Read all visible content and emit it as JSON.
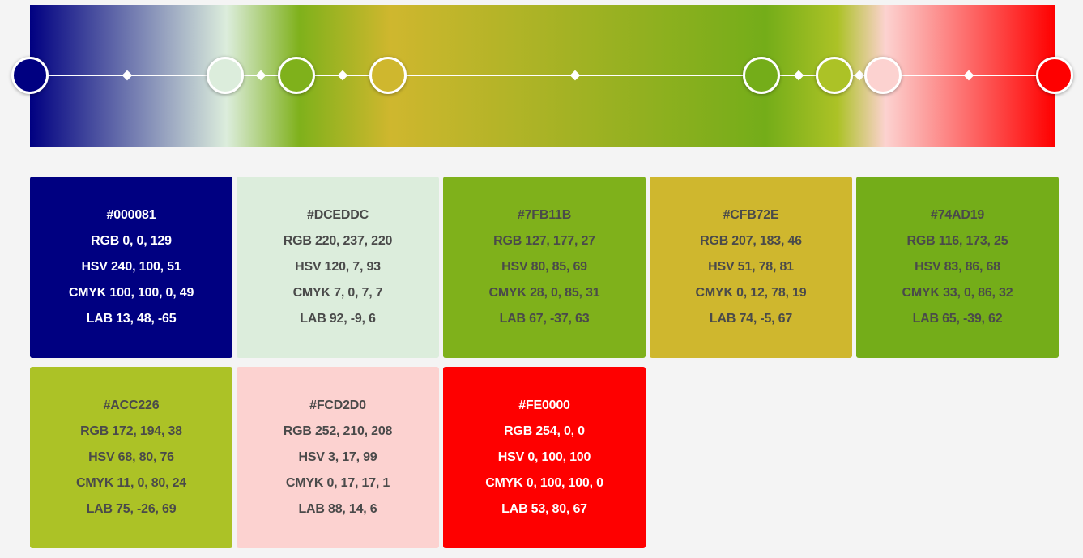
{
  "gradient": {
    "stops": [
      {
        "hex": "#000081",
        "color": "#000081"
      },
      {
        "hex": "#DCEDDC",
        "color": "#DCEDDC"
      },
      {
        "hex": "#7FB11B",
        "color": "#7FB11B"
      },
      {
        "hex": "#CFB72E",
        "color": "#CFB72E"
      },
      {
        "hex": "#74AD19",
        "color": "#74AD19"
      },
      {
        "hex": "#ACC226",
        "color": "#ACC226"
      },
      {
        "hex": "#FCD2D0",
        "color": "#FCD2D0"
      },
      {
        "hex": "#FE0000",
        "color": "#FE0000"
      }
    ]
  },
  "swatches": [
    {
      "hex": "#000081",
      "rgb": "RGB 0, 0, 129",
      "hsv": "HSV 240, 100, 51",
      "cmyk": "CMYK 100, 100, 0, 49",
      "lab": "LAB 13, 48, -65",
      "color": "#000081",
      "text": "light"
    },
    {
      "hex": "#DCEDDC",
      "rgb": "RGB 220, 237, 220",
      "hsv": "HSV 120, 7, 93",
      "cmyk": "CMYK 7, 0, 7, 7",
      "lab": "LAB 92, -9, 6",
      "color": "#DCEDDC",
      "text": "dark"
    },
    {
      "hex": "#7FB11B",
      "rgb": "RGB 127, 177, 27",
      "hsv": "HSV 80, 85, 69",
      "cmyk": "CMYK 28, 0, 85, 31",
      "lab": "LAB 67, -37, 63",
      "color": "#7FB11B",
      "text": "dark"
    },
    {
      "hex": "#CFB72E",
      "rgb": "RGB 207, 183, 46",
      "hsv": "HSV 51, 78, 81",
      "cmyk": "CMYK 0, 12, 78, 19",
      "lab": "LAB 74, -5, 67",
      "color": "#CFB72E",
      "text": "dark"
    },
    {
      "hex": "#74AD19",
      "rgb": "RGB 116, 173, 25",
      "hsv": "HSV 83, 86, 68",
      "cmyk": "CMYK 33, 0, 86, 32",
      "lab": "LAB 65, -39, 62",
      "color": "#74AD19",
      "text": "dark"
    },
    {
      "hex": "#ACC226",
      "rgb": "RGB 172, 194, 38",
      "hsv": "HSV 68, 80, 76",
      "cmyk": "CMYK 11, 0, 80, 24",
      "lab": "LAB 75, -26, 69",
      "color": "#ACC226",
      "text": "dark"
    },
    {
      "hex": "#FCD2D0",
      "rgb": "RGB 252, 210, 208",
      "hsv": "HSV 3, 17, 99",
      "cmyk": "CMYK 0, 17, 17, 1",
      "lab": "LAB 88, 14, 6",
      "color": "#FCD2D0",
      "text": "dark"
    },
    {
      "hex": "#FE0000",
      "rgb": "RGB 254, 0, 0",
      "hsv": "HSV 0, 100, 100",
      "cmyk": "CMYK 0, 100, 100, 0",
      "lab": "LAB 53, 80, 67",
      "color": "#FE0000",
      "text": "light"
    }
  ]
}
